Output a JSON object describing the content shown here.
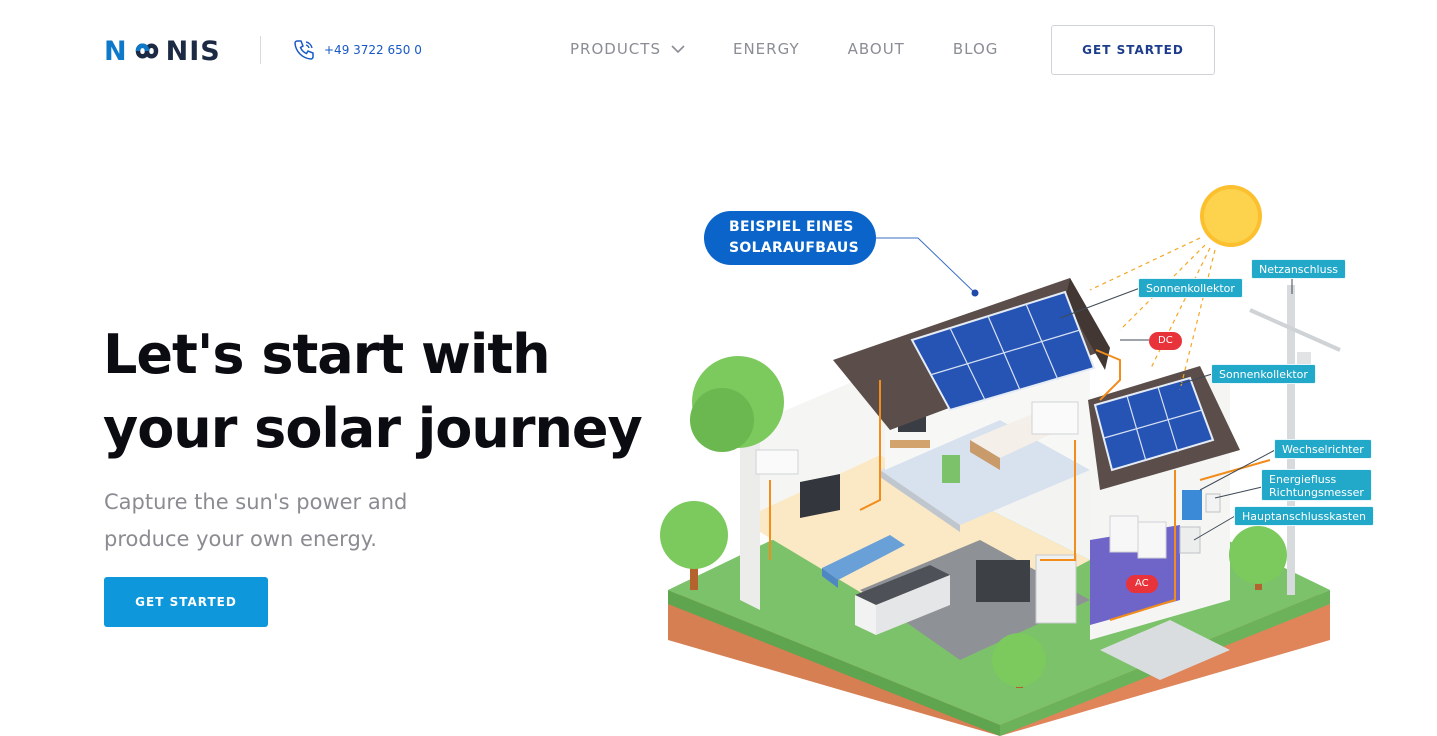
{
  "header": {
    "logo_text": "NOONIS",
    "phone": "+49 3722 650 0",
    "nav": [
      {
        "label": "PRODUCTS",
        "has_dropdown": true
      },
      {
        "label": "ENERGY"
      },
      {
        "label": "ABOUT"
      },
      {
        "label": "BLOG"
      }
    ],
    "cta_label": "GET STARTED"
  },
  "hero": {
    "title_line1": "Let's start with",
    "title_line2": "your solar journey",
    "subtitle_line1": "Capture the sun's power and",
    "subtitle_line2": "produce your own energy.",
    "cta_label": "GET STARTED"
  },
  "illustration": {
    "callout_line1": "BEISPIEL EINES",
    "callout_line2": "SOLARAUFBAUS",
    "labels": {
      "netzanschluss": "Netzanschluss",
      "sonnenkollektor_1": "Sonnenkollektor",
      "sonnenkollektor_2": "Sonnenkollektor",
      "wechselrichter": "Wechselrichter",
      "energiefluss_1": "Energiefluss",
      "energiefluss_2": "Richtungsmesser",
      "hauptanschlusskasten": "Hauptanschlusskasten",
      "dc": "DC",
      "ac": "AC"
    }
  },
  "colors": {
    "brand_blue": "#0d79c8",
    "cta_blue": "#0e97da",
    "callout_blue": "#0a64c9",
    "tag_teal": "#22a8c8",
    "red_pill": "#e8333b"
  }
}
